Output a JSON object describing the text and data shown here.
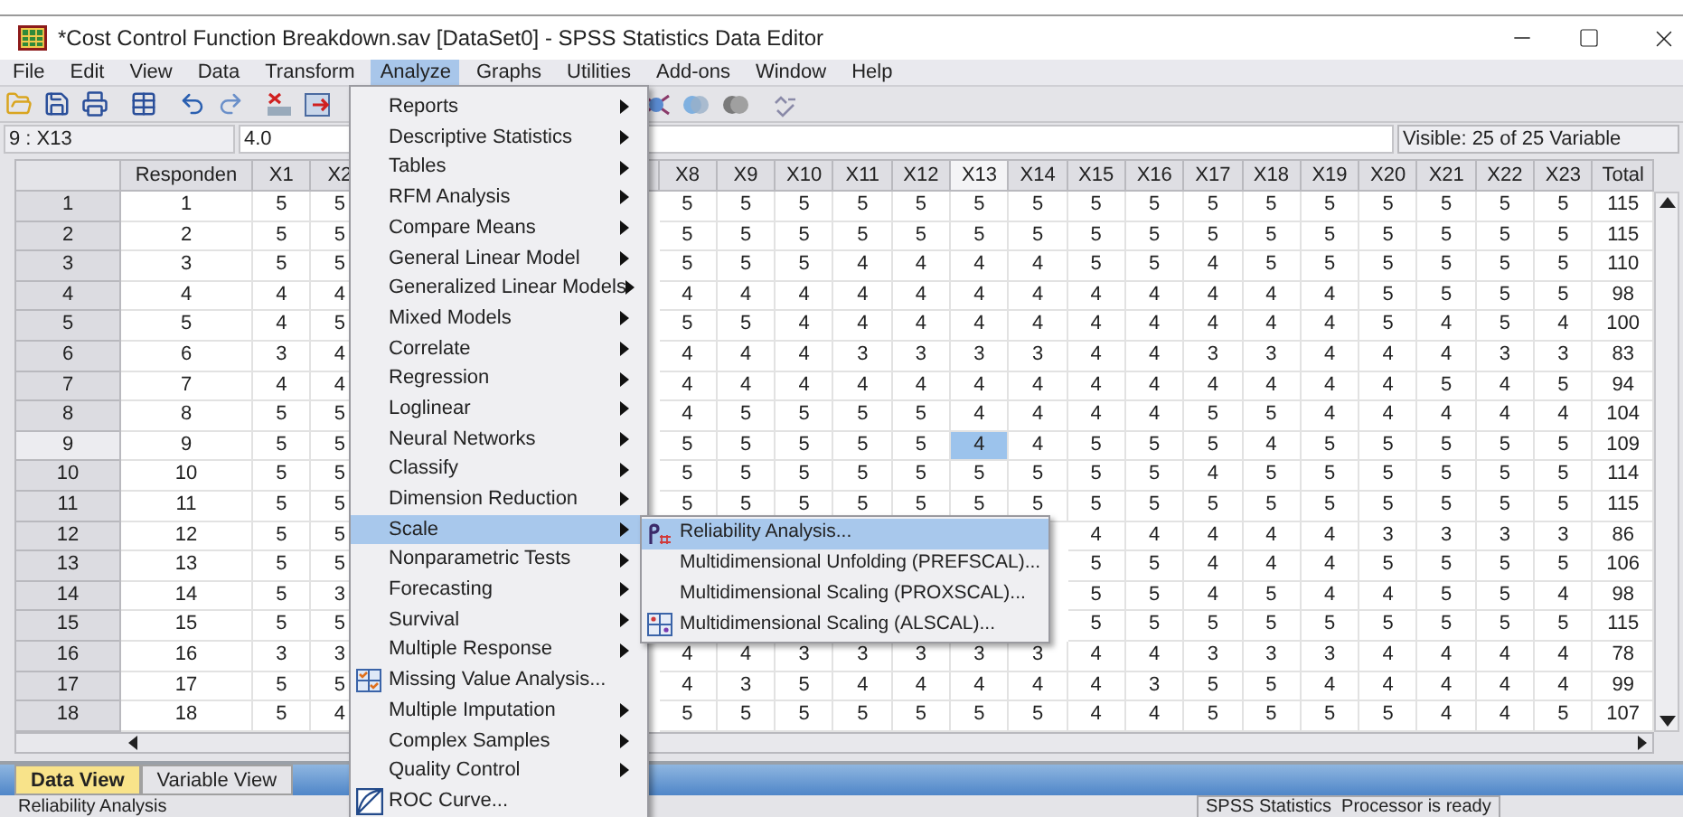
{
  "window": {
    "title": "*Cost Control Function Breakdown.sav [DataSet0] - SPSS Statistics Data Editor"
  },
  "menu_bar": [
    {
      "label": "File",
      "selected": false
    },
    {
      "label": "Edit",
      "selected": false
    },
    {
      "label": "View",
      "selected": false
    },
    {
      "label": "Data",
      "selected": false
    },
    {
      "label": "Transform",
      "selected": false
    },
    {
      "label": "Analyze",
      "selected": true
    },
    {
      "label": "Graphs",
      "selected": false
    },
    {
      "label": "Utilities",
      "selected": false
    },
    {
      "label": "Add-ons",
      "selected": false
    },
    {
      "label": "Window",
      "selected": false
    },
    {
      "label": "Help",
      "selected": false
    }
  ],
  "cell_reference": {
    "name": "9 : X13",
    "value": "4.0"
  },
  "visible_variables": "Visible: 25 of 25 Variable",
  "table": {
    "columns": [
      {
        "label": "Responden",
        "selected": false
      },
      {
        "label": "X1",
        "selected": false
      },
      {
        "label": "X2",
        "selected": false
      },
      {
        "label": "X8",
        "selected": false
      },
      {
        "label": "X9",
        "selected": false
      },
      {
        "label": "X10",
        "selected": false
      },
      {
        "label": "X11",
        "selected": false
      },
      {
        "label": "X12",
        "selected": false
      },
      {
        "label": "X13",
        "selected": true
      },
      {
        "label": "X14",
        "selected": false
      },
      {
        "label": "X15",
        "selected": false
      },
      {
        "label": "X16",
        "selected": false
      },
      {
        "label": "X17",
        "selected": false
      },
      {
        "label": "X18",
        "selected": false
      },
      {
        "label": "X19",
        "selected": false
      },
      {
        "label": "X20",
        "selected": false
      },
      {
        "label": "X21",
        "selected": false
      },
      {
        "label": "X22",
        "selected": false
      },
      {
        "label": "X23",
        "selected": false
      },
      {
        "label": "Total",
        "selected": false
      }
    ],
    "rows": [
      {
        "label": "1",
        "selected": false,
        "cells": [
          "1",
          "5",
          "5",
          "5",
          "5",
          "5",
          "5",
          "5",
          "5",
          "5",
          "5",
          "5",
          "5",
          "5",
          "5",
          "5",
          "5",
          "5",
          "5",
          "115"
        ]
      },
      {
        "label": "2",
        "selected": false,
        "cells": [
          "2",
          "5",
          "5",
          "5",
          "5",
          "5",
          "5",
          "5",
          "5",
          "5",
          "5",
          "5",
          "5",
          "5",
          "5",
          "5",
          "5",
          "5",
          "5",
          "115"
        ]
      },
      {
        "label": "3",
        "selected": false,
        "cells": [
          "3",
          "5",
          "5",
          "5",
          "5",
          "5",
          "4",
          "4",
          "4",
          "4",
          "5",
          "5",
          "4",
          "5",
          "5",
          "5",
          "5",
          "5",
          "5",
          "110"
        ]
      },
      {
        "label": "4",
        "selected": false,
        "cells": [
          "4",
          "4",
          "4",
          "4",
          "4",
          "4",
          "4",
          "4",
          "4",
          "4",
          "4",
          "4",
          "4",
          "4",
          "4",
          "5",
          "5",
          "5",
          "5",
          "98"
        ]
      },
      {
        "label": "5",
        "selected": false,
        "cells": [
          "5",
          "4",
          "5",
          "5",
          "5",
          "4",
          "4",
          "4",
          "4",
          "4",
          "4",
          "4",
          "4",
          "4",
          "4",
          "5",
          "4",
          "5",
          "4",
          "100"
        ]
      },
      {
        "label": "6",
        "selected": false,
        "cells": [
          "6",
          "3",
          "4",
          "4",
          "4",
          "4",
          "3",
          "3",
          "3",
          "3",
          "4",
          "4",
          "3",
          "3",
          "4",
          "4",
          "4",
          "3",
          "3",
          "83"
        ]
      },
      {
        "label": "7",
        "selected": false,
        "cells": [
          "7",
          "4",
          "4",
          "4",
          "4",
          "4",
          "4",
          "4",
          "4",
          "4",
          "4",
          "4",
          "4",
          "4",
          "4",
          "4",
          "5",
          "4",
          "5",
          "94"
        ]
      },
      {
        "label": "8",
        "selected": false,
        "cells": [
          "8",
          "5",
          "5",
          "4",
          "5",
          "5",
          "5",
          "5",
          "4",
          "4",
          "4",
          "4",
          "5",
          "5",
          "4",
          "4",
          "4",
          "4",
          "4",
          "104"
        ]
      },
      {
        "label": "9",
        "selected": true,
        "cells": [
          "9",
          "5",
          "5",
          "5",
          "5",
          "5",
          "5",
          "5",
          "4",
          "4",
          "5",
          "5",
          "5",
          "4",
          "5",
          "5",
          "5",
          "5",
          "5",
          "109"
        ]
      },
      {
        "label": "10",
        "selected": false,
        "cells": [
          "10",
          "5",
          "5",
          "5",
          "5",
          "5",
          "5",
          "5",
          "5",
          "5",
          "5",
          "5",
          "4",
          "5",
          "5",
          "5",
          "5",
          "5",
          "5",
          "114"
        ]
      },
      {
        "label": "11",
        "selected": false,
        "cells": [
          "11",
          "5",
          "5",
          "5",
          "5",
          "5",
          "5",
          "5",
          "5",
          "5",
          "5",
          "5",
          "5",
          "5",
          "5",
          "5",
          "5",
          "5",
          "5",
          "115"
        ]
      },
      {
        "label": "12",
        "selected": false,
        "cells": [
          "12",
          "5",
          "5",
          null,
          null,
          null,
          null,
          null,
          null,
          null,
          "4",
          "4",
          "4",
          "4",
          "4",
          "3",
          "3",
          "3",
          "3",
          "86"
        ]
      },
      {
        "label": "13",
        "selected": false,
        "cells": [
          "13",
          "5",
          "5",
          null,
          null,
          null,
          null,
          null,
          null,
          null,
          "5",
          "5",
          "4",
          "4",
          "4",
          "5",
          "5",
          "5",
          "5",
          "106"
        ]
      },
      {
        "label": "14",
        "selected": false,
        "cells": [
          "14",
          "5",
          "3",
          null,
          null,
          null,
          null,
          null,
          null,
          null,
          "5",
          "5",
          "4",
          "5",
          "4",
          "4",
          "5",
          "5",
          "4",
          "98"
        ]
      },
      {
        "label": "15",
        "selected": false,
        "cells": [
          "15",
          "5",
          "5",
          null,
          null,
          null,
          null,
          null,
          null,
          null,
          "5",
          "5",
          "5",
          "5",
          "5",
          "5",
          "5",
          "5",
          "5",
          "115"
        ]
      },
      {
        "label": "16",
        "selected": false,
        "cells": [
          "16",
          "3",
          "3",
          "4",
          "4",
          "3",
          "3",
          "3",
          "3",
          "3",
          "4",
          "4",
          "3",
          "3",
          "3",
          "4",
          "4",
          "4",
          "4",
          "78"
        ]
      },
      {
        "label": "17",
        "selected": false,
        "cells": [
          "17",
          "5",
          "5",
          "4",
          "3",
          "5",
          "4",
          "4",
          "4",
          "4",
          "4",
          "3",
          "5",
          "5",
          "4",
          "4",
          "4",
          "4",
          "4",
          "99"
        ]
      },
      {
        "label": "18",
        "selected": false,
        "cells": [
          "18",
          "5",
          "4",
          "5",
          "5",
          "5",
          "5",
          "5",
          "5",
          "5",
          "4",
          "4",
          "5",
          "5",
          "5",
          "5",
          "4",
          "4",
          "5",
          "107"
        ]
      }
    ]
  },
  "analyze_menu": [
    {
      "label": "Reports",
      "kind": "submenu",
      "selected": false
    },
    {
      "label": "Descriptive Statistics",
      "kind": "submenu",
      "selected": false
    },
    {
      "label": "Tables",
      "kind": "submenu",
      "selected": false
    },
    {
      "label": "RFM Analysis",
      "kind": "submenu",
      "selected": false
    },
    {
      "label": "Compare Means",
      "kind": "submenu",
      "selected": false
    },
    {
      "label": "General Linear Model",
      "kind": "submenu",
      "selected": false
    },
    {
      "label": "Generalized Linear Models",
      "kind": "submenu",
      "selected": false
    },
    {
      "label": "Mixed Models",
      "kind": "submenu",
      "selected": false
    },
    {
      "label": "Correlate",
      "kind": "submenu",
      "selected": false
    },
    {
      "label": "Regression",
      "kind": "submenu",
      "selected": false
    },
    {
      "label": "Loglinear",
      "kind": "submenu",
      "selected": false
    },
    {
      "label": "Neural Networks",
      "kind": "submenu",
      "selected": false
    },
    {
      "label": "Classify",
      "kind": "submenu",
      "selected": false
    },
    {
      "label": "Dimension Reduction",
      "kind": "submenu",
      "selected": false
    },
    {
      "label": "Scale",
      "kind": "submenu",
      "selected": true
    },
    {
      "label": "Nonparametric Tests",
      "kind": "submenu",
      "selected": false
    },
    {
      "label": "Forecasting",
      "kind": "submenu",
      "selected": false
    },
    {
      "label": "Survival",
      "kind": "submenu",
      "selected": false
    },
    {
      "label": "Multiple Response",
      "kind": "submenu",
      "selected": false
    },
    {
      "label": "Missing Value Analysis...",
      "kind": "dialog",
      "selected": false
    },
    {
      "label": "Multiple Imputation",
      "kind": "submenu",
      "selected": false
    },
    {
      "label": "Complex Samples",
      "kind": "submenu",
      "selected": false
    },
    {
      "label": "Quality Control",
      "kind": "submenu",
      "selected": false
    },
    {
      "label": "ROC Curve...",
      "kind": "dialog",
      "selected": false
    }
  ],
  "scale_submenu": [
    {
      "label": "Reliability Analysis...",
      "icon": true,
      "selected": true
    },
    {
      "label": "Multidimensional Unfolding (PREFSCAL)...",
      "icon": false,
      "selected": false
    },
    {
      "label": "Multidimensional Scaling (PROXSCAL)...",
      "icon": false,
      "selected": false
    },
    {
      "label": "Multidimensional Scaling (ALSCAL)...",
      "icon": true,
      "selected": false
    }
  ],
  "view_tabs": [
    {
      "label": "Data View",
      "selected": true
    },
    {
      "label": "Variable View",
      "selected": false
    }
  ],
  "status_bar": {
    "left": "Reliability Analysis",
    "processor": "SPSS Statistics  Processor is ready"
  }
}
